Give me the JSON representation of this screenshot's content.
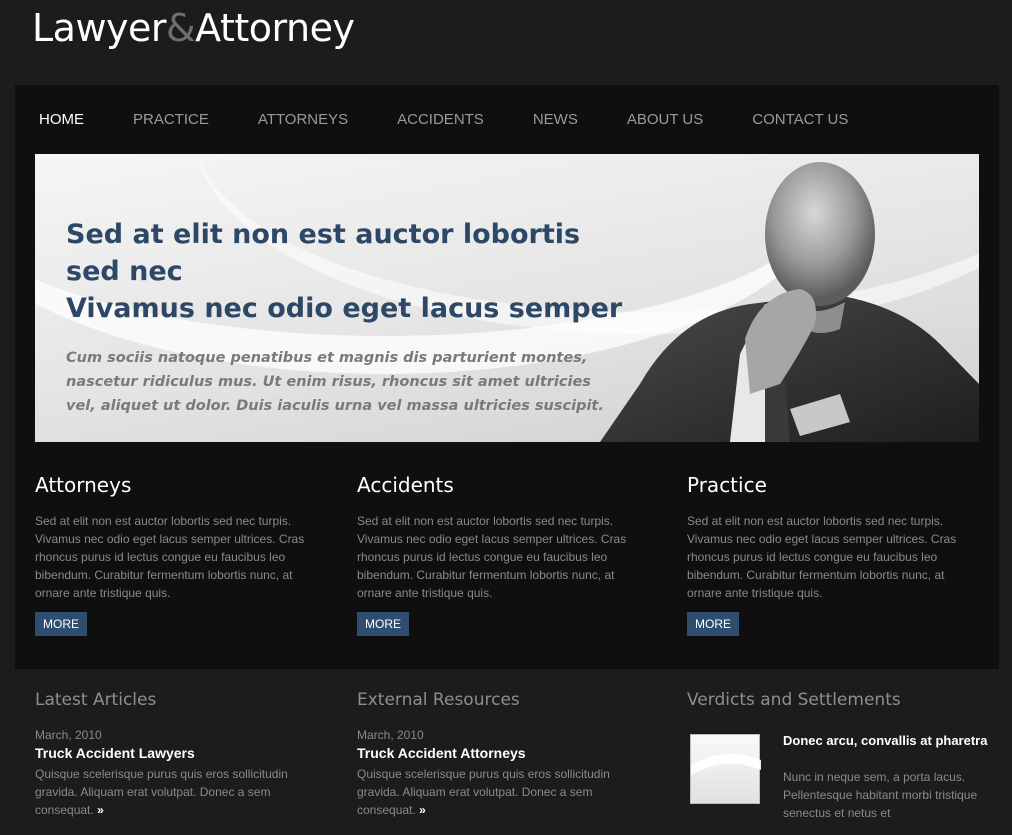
{
  "logo": {
    "part1": "Lawyer",
    "amp": "&",
    "part2": "Attorney"
  },
  "nav": {
    "items": [
      {
        "label": "HOME"
      },
      {
        "label": "PRACTICE"
      },
      {
        "label": "ATTORNEYS"
      },
      {
        "label": "ACCIDENTS"
      },
      {
        "label": "NEWS"
      },
      {
        "label": "ABOUT US"
      },
      {
        "label": "CONTACT US"
      }
    ],
    "active_index": 0
  },
  "hero": {
    "title_line1": "Sed at elit non est auctor lobortis sed nec",
    "title_line2": "Vivamus nec odio eget lacus semper",
    "text": "Cum sociis natoque penatibus et magnis dis parturient montes, nascetur ridiculus mus. Ut enim risus, rhoncus sit amet ultricies vel, aliquet ut dolor. Duis iaculis urna vel massa ultricies suscipit."
  },
  "columns": [
    {
      "title": "Attorneys",
      "text": "Sed at elit non est auctor lobortis sed nec turpis. Vivamus nec odio eget lacus semper ultrices. Cras rhoncus purus id lectus congue eu faucibus leo bibendum. Curabitur fermentum lobortis nunc, at ornare ante tristique quis.",
      "button": "MORE"
    },
    {
      "title": "Accidents",
      "text": "Sed at elit non est auctor lobortis sed nec turpis. Vivamus nec odio eget lacus semper ultrices. Cras rhoncus purus id lectus congue eu faucibus leo bibendum. Curabitur fermentum lobortis nunc, at ornare ante tristique quis.",
      "button": "MORE"
    },
    {
      "title": "Practice",
      "text": "Sed at elit non est auctor lobortis sed nec turpis. Vivamus nec odio eget lacus semper ultrices. Cras rhoncus purus id lectus congue eu faucibus leo bibendum. Curabitur fermentum lobortis nunc, at ornare ante tristique quis.",
      "button": "MORE"
    }
  ],
  "latest_articles": {
    "heading": "Latest Articles",
    "date": "March, 2010",
    "title": "Truck Accident Lawyers",
    "text": "Quisque scelerisque purus quis eros sollicitudin gravida. Aliquam erat volutpat. Donec a sem consequat.",
    "arrow": "»"
  },
  "external_resources": {
    "heading": "External Resources",
    "date": "March, 2010",
    "title": "Truck Accident Attorneys",
    "text": "Quisque scelerisque purus quis eros sollicitudin gravida. Aliquam erat volutpat. Donec a sem consequat.",
    "arrow": "»"
  },
  "verdicts": {
    "heading": "Verdicts and Settlements",
    "title": "Donec arcu, convallis at pharetra",
    "text": "Nunc in neque sem, a porta lacus. Pellentesque habitant morbi tristique senectus et netus et"
  },
  "colors": {
    "accent": "#2d4866",
    "button": "#2f4d6f",
    "background": "#1c1c1c",
    "content_box": "#0f0f0f"
  }
}
